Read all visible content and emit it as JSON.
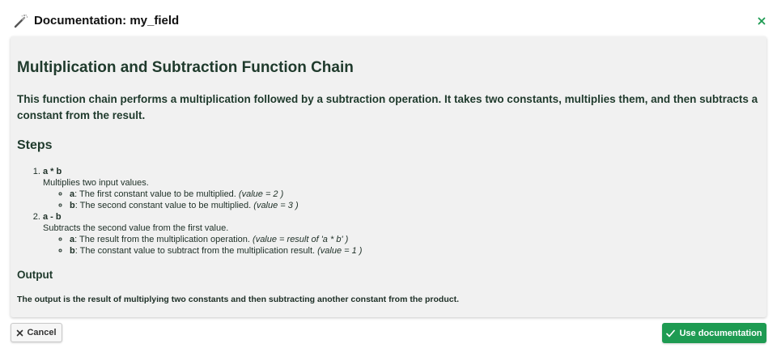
{
  "dialog": {
    "title": "Documentation: my_field",
    "header_icon": "magic-wand-icon",
    "close_icon": "close-icon"
  },
  "doc": {
    "title": "Multiplication and Subtraction Function Chain",
    "summary": "This function chain performs a multiplication followed by a subtraction operation. It takes two constants, multiplies them, and then subtracts a constant from the result.",
    "steps_heading": "Steps",
    "steps": [
      {
        "name": "a * b",
        "description": "Multiplies two input values.",
        "params": [
          {
            "name": "a",
            "text": ": The first constant value to be multiplied. ",
            "value": "(value = 2 )"
          },
          {
            "name": "b",
            "text": ": The second constant value to be multiplied. ",
            "value": "(value = 3 )"
          }
        ]
      },
      {
        "name": "a - b",
        "description": "Subtracts the second value from the first value.",
        "params": [
          {
            "name": "a",
            "text": ": The result from the multiplication operation. ",
            "value": "(value = result of 'a * b' )"
          },
          {
            "name": "b",
            "text": ": The constant value to subtract from the multiplication result. ",
            "value": "(value = 1 )"
          }
        ]
      }
    ],
    "output_heading": "Output",
    "output_text": "The output is the result of multiplying two constants and then subtracting another constant from the product."
  },
  "footer": {
    "cancel_label": "Cancel",
    "cancel_icon": "close-icon",
    "use_label": "Use documentation",
    "use_icon": "checkmark-icon"
  },
  "colors": {
    "accent": "#1e9b52",
    "panel_bg": "#f1f1f1",
    "text_dark_green": "#1f3a2c"
  }
}
